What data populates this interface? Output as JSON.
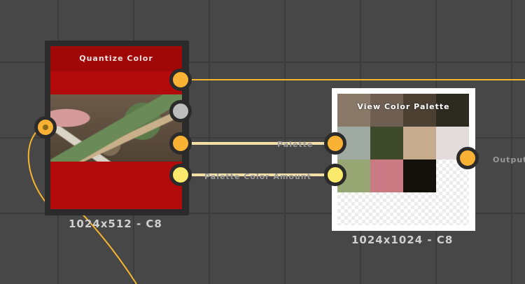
{
  "canvas": {
    "grid_color": "#3c3c3c",
    "background_color": "#474747",
    "wire_color": "#f5b52e",
    "link_color": "#f3dfa8"
  },
  "node_quantize": {
    "title": "Quantize Color",
    "size_label": "1024x512 - C8",
    "color": "#b30b0b"
  },
  "node_palette": {
    "title": "View Color Palette",
    "size_label": "1024x1024 - C8",
    "swatches": [
      "#8a7868",
      "#6e5f52",
      "#4c4033",
      "#2d2b1f",
      "#9eaaa2",
      "#3e4a2b",
      "#c7ab8e",
      "#e2dcdc",
      "#97a672",
      "#c97a82",
      "#14110c"
    ]
  },
  "links": {
    "palette_label": "Palette",
    "palette_amount_label": "Palette Color Amount",
    "output_label": "Output"
  }
}
